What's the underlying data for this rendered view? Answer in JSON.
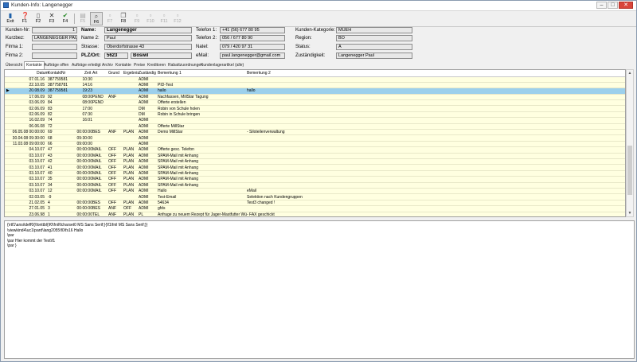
{
  "window": {
    "title": "Kunden-Info: Langenegger"
  },
  "toolbar": {
    "buttons": [
      {
        "label": "Exit",
        "icon": "door-icon"
      },
      {
        "label": "F1",
        "icon": "help-icon"
      },
      {
        "label": "F2",
        "icon": "new-doc-icon"
      },
      {
        "label": "F3",
        "icon": "delete-icon"
      },
      {
        "label": "F4",
        "icon": "check-icon"
      },
      {
        "label": "F5",
        "icon": "print-icon"
      },
      {
        "label": "F6",
        "icon": "search-icon"
      },
      {
        "label": "F7",
        "icon": "blank-icon"
      },
      {
        "label": "F8",
        "icon": "copy-icon"
      },
      {
        "label": "F9",
        "icon": "blank-icon"
      },
      {
        "label": "F10",
        "icon": "blank-icon"
      },
      {
        "label": "F11",
        "icon": "blank-icon"
      },
      {
        "label": "F12",
        "icon": "blank-icon"
      }
    ]
  },
  "fields": {
    "kunden_nr": {
      "label": "Kunden-Nr:",
      "value": "1"
    },
    "kurzbez": {
      "label": "Kurzbez:",
      "value": "LANGENEGGER PAUL"
    },
    "firma1": {
      "label": "Firma 1:",
      "value": ""
    },
    "firma2": {
      "label": "Firma 2:",
      "value": ""
    },
    "name": {
      "label": "Name:",
      "value": "Langenegger"
    },
    "name2": {
      "label": "Name 2:",
      "value": "Paul"
    },
    "strasse": {
      "label": "Strasse:",
      "value": "Oberdorfstrasse 43"
    },
    "plz_ort": {
      "label": "PLZ/Ort:",
      "plz": "5623",
      "ort": "Boswil"
    },
    "telefon1": {
      "label": "Telefon 1:",
      "value": "+41 (56) 677 80 95"
    },
    "telefon2": {
      "label": "Telefon 2:",
      "value": "056 / 677 80 90"
    },
    "natel": {
      "label": "Natel:",
      "value": "079 / 420 97 31"
    },
    "email": {
      "label": "eMail:",
      "value": "paul.langenegger@gmail.com"
    },
    "kategorie": {
      "label": "Kunden-Kategorie:",
      "value": "MUEH"
    },
    "region": {
      "label": "Region:",
      "value": "BO"
    },
    "status": {
      "label": "Status:",
      "value": "A"
    },
    "zustaendig": {
      "label": "Zuständigkeit:",
      "value": "Langenegger Paul"
    }
  },
  "tabs": [
    "Übersicht",
    "Kontakte",
    "Aufträge offen",
    "Aufträge erledigt",
    "Archiv",
    "Kontakte",
    "Preise",
    "Kreditoren",
    "Rabattzuordnungen",
    "Kundenlagerartikel (alle)"
  ],
  "active_tab": 1,
  "grid": {
    "headers": [
      "Datum",
      "KontaktNr",
      "Zeit",
      "Art",
      "Grund",
      "Ergebnis",
      "Zuständig",
      "Bemerkung 1",
      "Bemerkung 2"
    ],
    "rows": [
      [
        "07.01.16",
        "387759581",
        "10:30",
        "",
        "",
        "",
        "ADMI",
        "",
        ""
      ],
      [
        "22.10.05",
        "387758781",
        "14:16",
        "",
        "",
        "",
        "ADMI",
        "PID-Test",
        ""
      ],
      [
        "20.08.09",
        "387759581",
        "19:23",
        "",
        "",
        "",
        "ADMI",
        "hallo",
        "hallo"
      ],
      [
        "17.06.09",
        "92",
        "08:00",
        "PEND",
        "ANF",
        "",
        "ADMI",
        "Nachfassen, MillStar Tagung",
        ""
      ],
      [
        "03.06.09",
        "84",
        "08:00",
        "PEND",
        "",
        "",
        "ADMI",
        "Offerte erstellen",
        ""
      ],
      [
        "02.06.09",
        "83",
        "17:00",
        "",
        "",
        "",
        "DM",
        "Robin von Schule holen",
        ""
      ],
      [
        "02.06.09",
        "82",
        "07:30",
        "",
        "",
        "",
        "DM",
        "Robin in Schule bringen",
        ""
      ],
      [
        "16.02.09",
        "74",
        "16:01",
        "",
        "",
        "",
        "ADMI",
        "",
        ""
      ],
      [
        "06.06.08",
        "72",
        "",
        "",
        "",
        "",
        "ADMI",
        "Offerte MillStar",
        ""
      ],
      [
        "06.05.08 00:00:00",
        "69",
        "00:00:00",
        "BES",
        "ANF",
        "PLAN",
        "ADMI",
        "Demo MillStar",
        "- Siloteilenverwaltung"
      ],
      [
        "30.04.08 09:30:00",
        "68",
        "09:30:00",
        "",
        "",
        "",
        "ADMI",
        "",
        ""
      ],
      [
        "11.03.08 09:00:00",
        "66",
        "09:00:00",
        "",
        "",
        "",
        "ADMI",
        "",
        ""
      ],
      [
        "04.10.07",
        "47",
        "00:00:00",
        "MAIL",
        "OFF",
        "PLAN",
        "ADMI",
        "Offerte gesc. Telefon",
        ""
      ],
      [
        "03.10.07",
        "43",
        "00:00:00",
        "MAIL",
        "OFF",
        "PLAN",
        "ADMI",
        "SPAM-Mail mit Anhang",
        ""
      ],
      [
        "03.10.07",
        "42",
        "00:00:00",
        "MAIL",
        "OFF",
        "PLAN",
        "ADMI",
        "SPAM-Mail mit Anhang",
        ""
      ],
      [
        "03.10.07",
        "41",
        "00:00:00",
        "MAIL",
        "OFF",
        "PLAN",
        "ADMI",
        "SPAM-Mail mit Anhang",
        ""
      ],
      [
        "03.10.07",
        "40",
        "00:00:00",
        "MAIL",
        "OFF",
        "PLAN",
        "ADMI",
        "SPAM-Mail mit Anhang",
        ""
      ],
      [
        "03.10.07",
        "35",
        "00:00:00",
        "MAIL",
        "OFF",
        "PLAN",
        "ADMI",
        "SPAM-Mail mit Anhang",
        ""
      ],
      [
        "03.10.07",
        "34",
        "00:00:00",
        "MAIL",
        "OFF",
        "PLAN",
        "ADMI",
        "SPAM-Mail mit Anhang",
        ""
      ],
      [
        "03.10.07",
        "12",
        "00:00:00",
        "MAIL",
        "OFF",
        "PLAN",
        "ADMI",
        "Hallo",
        "eMail"
      ],
      [
        "02.03.05",
        "-9",
        "",
        "",
        "",
        "",
        "ADMI",
        "Test-Email",
        "Selektion nach Kundengruppen"
      ],
      [
        "21.02.05",
        "4",
        "00:00:00",
        "BES",
        "OFF",
        "PLAN",
        "ADMI",
        "54634",
        "Test3 changed !"
      ],
      [
        "27.01.05",
        "3",
        "00:00:00",
        "BES",
        "ANF",
        "OFF",
        "ADMI",
        "gfds",
        ""
      ],
      [
        "23.06.98",
        "1",
        "00:00:00",
        "TEL",
        "ANF",
        "PLAN",
        "PL",
        "Anfrage zu neuem Rezept für Jager-Mastfutter Würfel",
        "- FAX geschickt"
      ]
    ],
    "selected_row": 2
  },
  "memo": {
    "lines": [
      "{\\rtf1\\ansi\\deff0{\\fonttbl{\\f0\\fnil\\fcharset0 MS Sans Serif;}{\\f1\\fnil MS Sans Serif;}}",
      "\\viewkind4\\uc1\\pard\\lang2055\\f0\\fs16 Hallo",
      "\\par",
      "\\par Hier kommt der Text\\f1",
      "\\par }"
    ]
  }
}
